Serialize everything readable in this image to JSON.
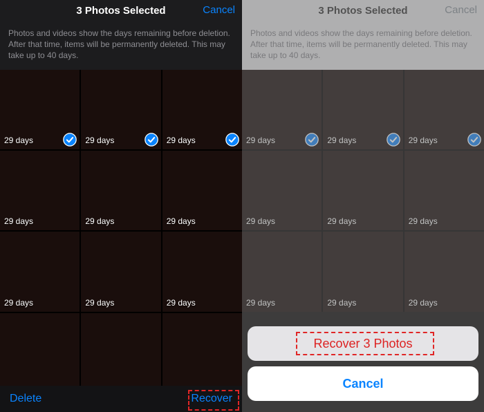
{
  "left": {
    "header": {
      "title": "3 Photos Selected",
      "cancel": "Cancel"
    },
    "hint": "Photos and videos show the days remaining before deletion. After that time, items will be permanently deleted. This may take up to 40 days.",
    "cells": [
      {
        "days": "29 days",
        "selected": true
      },
      {
        "days": "29 days",
        "selected": true
      },
      {
        "days": "29 days",
        "selected": true
      },
      {
        "days": "29 days",
        "selected": false
      },
      {
        "days": "29 days",
        "selected": false
      },
      {
        "days": "29 days",
        "selected": false
      },
      {
        "days": "29 days",
        "selected": false
      },
      {
        "days": "29 days",
        "selected": false
      },
      {
        "days": "29 days",
        "selected": false
      },
      {
        "days": "",
        "selected": false
      },
      {
        "days": "",
        "selected": false
      },
      {
        "days": "",
        "selected": false
      }
    ],
    "bottom": {
      "delete": "Delete",
      "recover": "Recover"
    }
  },
  "right": {
    "header": {
      "title": "3 Photos Selected",
      "cancel": "Cancel"
    },
    "hint": "Photos and videos show the days remaining before deletion. After that time, items will be permanently deleted. This may take up to 40 days.",
    "cells": [
      {
        "days": "29 days",
        "selected": true
      },
      {
        "days": "29 days",
        "selected": true
      },
      {
        "days": "29 days",
        "selected": true
      },
      {
        "days": "29 days",
        "selected": false
      },
      {
        "days": "29 days",
        "selected": false
      },
      {
        "days": "29 days",
        "selected": false
      },
      {
        "days": "29 days",
        "selected": false
      },
      {
        "days": "29 days",
        "selected": false
      },
      {
        "days": "29 days",
        "selected": false
      }
    ],
    "sheet": {
      "recover": "Recover 3 Photos",
      "cancel": "Cancel"
    }
  }
}
